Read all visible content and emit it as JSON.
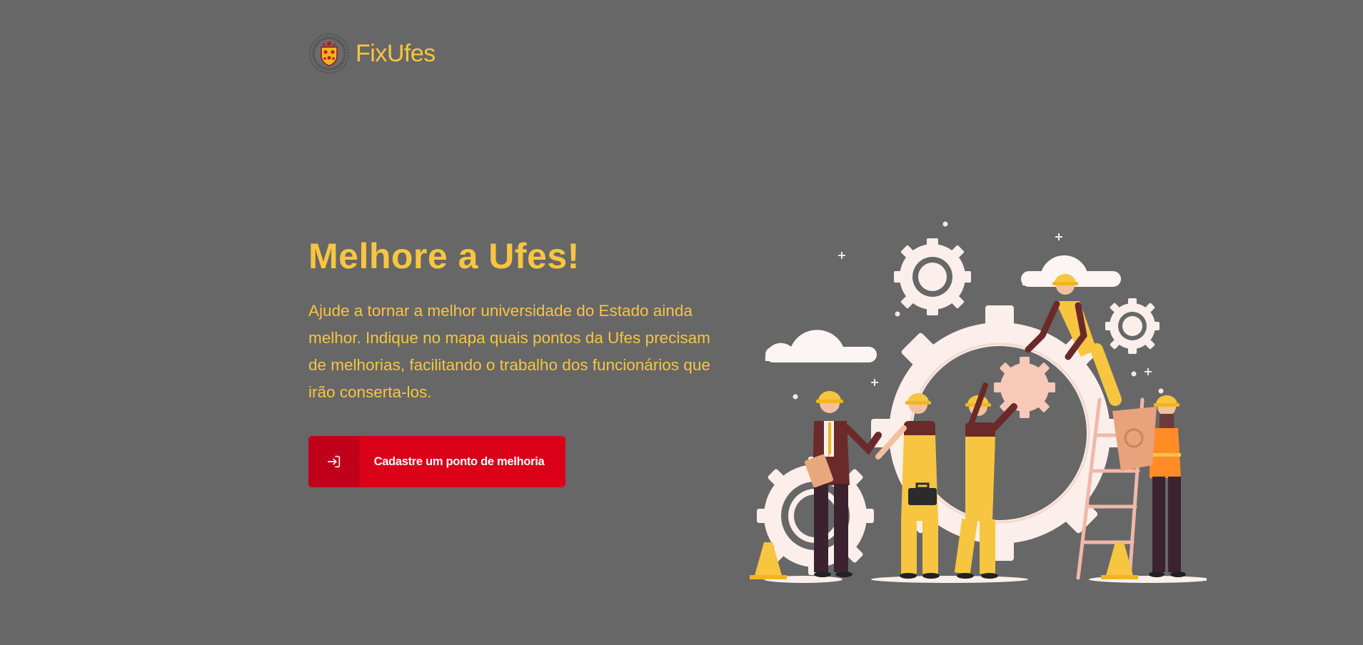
{
  "header": {
    "logo_icon": "ufes-crest-icon",
    "brand_name": "FixUfes"
  },
  "hero": {
    "title": "Melhore a Ufes!",
    "description": "Ajude a tornar a melhor universidade do Estado ainda melhor. Indique no mapa quais pontos da Ufes precisam de melhorias, facilitando o trabalho dos funcionários que irão conserta-los.",
    "cta": {
      "icon": "sign-in-icon",
      "label": "Cadastre um ponto de melhoria"
    },
    "illustration": "workers-fixing-gears-illustration"
  },
  "colors": {
    "background": "#676767",
    "accent": "#F7C540",
    "button": "#DA0018",
    "button_icon_bg": "#C0001A"
  }
}
